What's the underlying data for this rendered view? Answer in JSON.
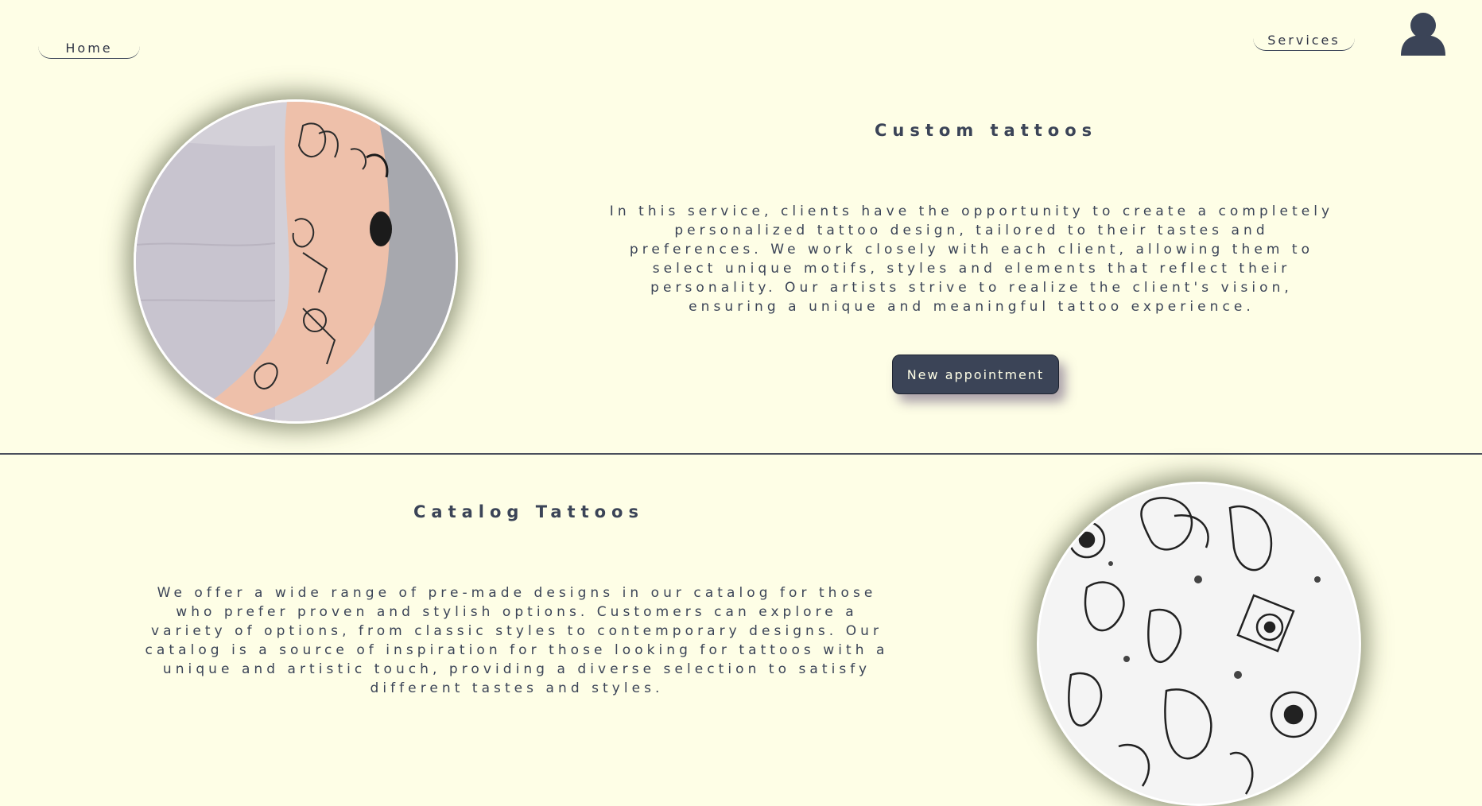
{
  "nav": {
    "home_label": "Home",
    "services_label": "Services",
    "user_icon": "user-icon"
  },
  "sections": [
    {
      "title": "Custom tattoos",
      "text": "In this service, clients have the opportunity to create a completely personalized tattoo design, tailored to their tastes and preferences. We work closely with each client, allowing them to select unique motifs, styles and elements that reflect their personality. Our artists strive to realize the client's vision, ensuring a unique and meaningful tattoo experience.",
      "button_label": "New appointment"
    },
    {
      "title": "Catalog Tattoos",
      "text": "We offer a wide range of pre-made designs in our catalog for those who prefer proven and stylish options. Customers can explore a variety of options, from classic styles to contemporary designs. Our catalog is a source of inspiration for those looking for tattoos with a unique and artistic touch, providing a diverse selection to satisfy different tastes and styles."
    }
  ],
  "colors": {
    "background": "#fefee6",
    "text": "#3b4457",
    "button_bg": "#3b4457",
    "button_text": "#fefee6"
  }
}
